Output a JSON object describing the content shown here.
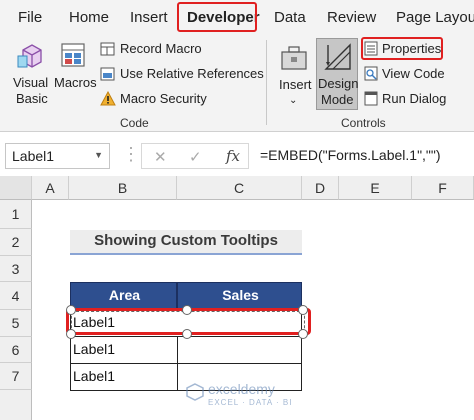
{
  "menu": {
    "tabs": [
      "File",
      "Home",
      "Insert",
      "Developer",
      "Data",
      "Review",
      "Page Layout"
    ],
    "active_tab": "Developer"
  },
  "ribbon": {
    "code_group": {
      "label": "Code",
      "visual_basic": "Visual\nBasic",
      "visual_basic_l1": "Visual",
      "visual_basic_l2": "Basic",
      "macros": "Macros",
      "record_macro": "Record Macro",
      "relative_refs": "Use Relative References",
      "macro_security": "Macro Security"
    },
    "controls_group": {
      "label": "Controls",
      "insert": "Insert",
      "design_mode_l1": "Design",
      "design_mode_l2": "Mode",
      "properties": "Properties",
      "view_code": "View Code",
      "run_dialog": "Run Dialog"
    }
  },
  "formula_bar": {
    "name_box": "Label1",
    "cancel_symbol": "✕",
    "enter_symbol": "✓",
    "fx_symbol": "fx",
    "formula": "=EMBED(\"Forms.Label.1\",\"\")"
  },
  "grid": {
    "columns": [
      "A",
      "B",
      "C",
      "D",
      "E",
      "F"
    ],
    "rows": [
      "1",
      "2",
      "3",
      "4",
      "5",
      "6",
      "7"
    ],
    "title": "Showing Custom Tooltips",
    "table_headers": [
      "Area",
      "Sales"
    ],
    "table_rows": [
      [
        "Label1",
        ""
      ],
      [
        "Label1",
        ""
      ],
      [
        "Label1",
        ""
      ]
    ]
  },
  "watermark": {
    "name": "exceldemy",
    "tagline": "EXCEL · DATA · BI"
  },
  "colors": {
    "highlight_red": "#e02020",
    "table_header_bg": "#2e4f8f",
    "title_underline": "#8aa4d4"
  }
}
